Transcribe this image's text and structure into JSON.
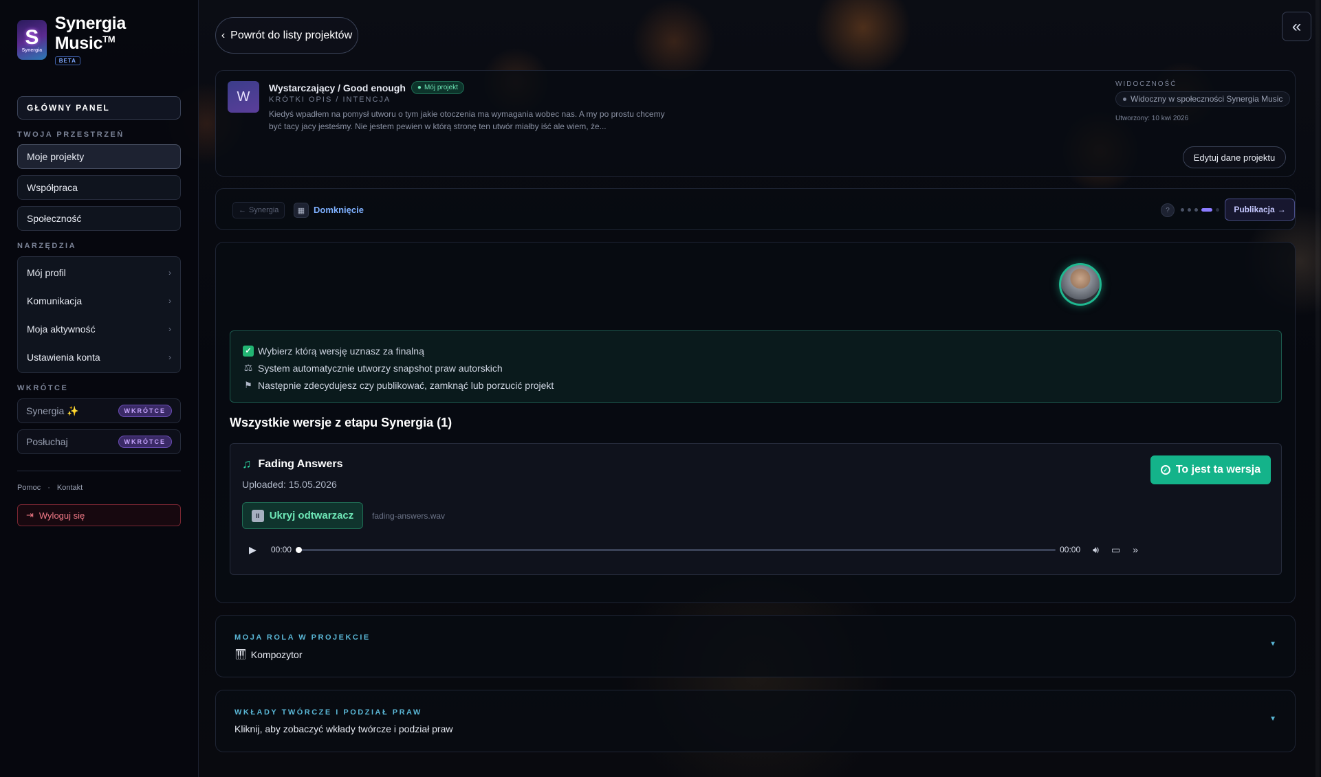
{
  "brand": {
    "name": "Synergia Music",
    "tm": "TM",
    "beta": "BETA",
    "logo_letter": "S",
    "logo_sub": "Synergia"
  },
  "sidebar": {
    "panel_button": "GŁÓWNY PANEL",
    "workspace_label": "TWOJA PRZESTRZEŃ",
    "workspace_items": [
      "Moje projekty",
      "Współpraca",
      "Społeczność"
    ],
    "tools_label": "NARZĘDZIA",
    "tools_items": [
      "Mój profil",
      "Komunikacja",
      "Moja aktywność",
      "Ustawienia konta"
    ],
    "soon_label": "WKRÓTCE",
    "soon_items": [
      {
        "label": "Synergia ✨",
        "badge": "WKRÓTCE"
      },
      {
        "label": "Posłuchaj",
        "badge": "WKRÓTCE"
      }
    ],
    "footer_links": [
      "Pomoc",
      "·",
      "Kontakt"
    ],
    "logout": "Wyloguj się"
  },
  "header": {
    "back_button": "Powrót do listy projektów",
    "collapse_icon": "double-chevron-left-icon"
  },
  "project": {
    "avatar_letter": "W",
    "title": "Wystarczający / Good enough",
    "mine_badge": "Mój projekt",
    "subtitle": "KRÓTKI OPIS / INTENCJA",
    "description": "Kiedyś wpadłem na pomysł utworu o tym jakie otoczenia ma wymagania wobec nas. A my po prostu chcemy być tacy jacy jesteśmy. Nie jestem pewien w którą stronę ten utwór miałby iść ale wiem, że...",
    "visibility_label": "WIDOCZNOŚĆ",
    "visibility_value": "Widoczny w społeczności Synergia Music",
    "created": "Utworzony: 10 kwi 2026",
    "edit_button": "Edytuj dane projektu"
  },
  "stage": {
    "prev": "Synergia",
    "current": "Domknięcie",
    "help": "?",
    "next": "Publikacja"
  },
  "info": [
    "Wybierz którą wersję uznasz za finalną",
    "System automatycznie utworzy snapshot praw autorskich",
    "Następnie zdecydujesz czy publikować, zamknąć lub porzucić projekt"
  ],
  "versions": {
    "title": "Wszystkie wersje z etapu Synergia (1)",
    "items": [
      {
        "name": "Fading Answers",
        "uploaded": "Uploaded: 15.05.2026",
        "choose_button": "To jest ta wersja",
        "hide_player": "Ukryj odtwarzacz",
        "file": "fading-answers.wav",
        "time_current": "00:00",
        "time_total": "00:00",
        "progress": 0
      }
    ]
  },
  "role": {
    "label": "MOJA ROLA W PROJEKCIE",
    "value": "Kompozytor"
  },
  "contributions": {
    "label": "WKŁADY TWÓRCZE I PODZIAŁ PRAW",
    "value": "Kliknij, aby zobaczyć wkłady twórcze i podział praw"
  },
  "colors": {
    "accent": "#14b38a",
    "stage": "#7eb0ff",
    "danger": "#f27a87"
  }
}
